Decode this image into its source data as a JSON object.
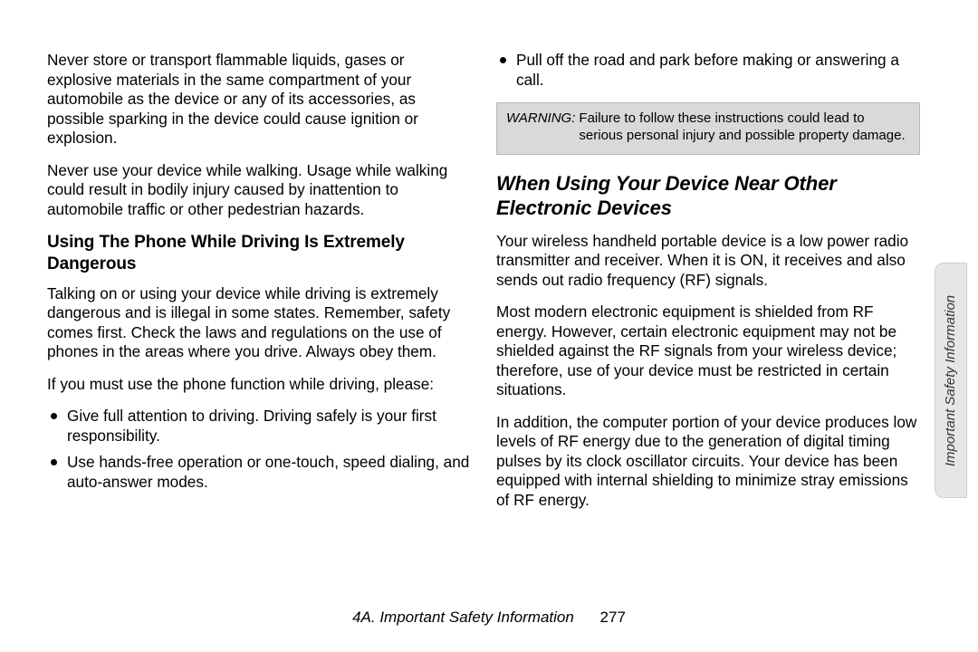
{
  "left": {
    "p1": "Never store or transport flammable liquids, gases or explosive materials in the same compartment of your automobile as the device or any of its accessories, as possible sparking in the device could cause ignition or explosion.",
    "p2": "Never use your device while walking. Usage while walking could result in bodily injury caused by inattention to automobile traffic or other pedestrian hazards.",
    "sub_head": "Using The Phone While Driving Is Extremely Dangerous",
    "p3": "Talking on or using your device while driving is extremely dangerous and is illegal in some states. Remember, safety comes first. Check the laws and regulations on the use of phones in the areas where you drive. Always obey them.",
    "p4": "If you must use the phone function while driving, please:",
    "bullets": [
      "Give full attention to driving. Driving safely is your first responsibility.",
      "Use hands-free operation or one-touch, speed dialing, and auto-answer modes."
    ]
  },
  "right": {
    "bullets_top": [
      "Pull off the road and park before making or answering a call."
    ],
    "warning_label": "WARNING:",
    "warning_text": "Failure to follow these instructions could lead to serious personal injury and possible property damage.",
    "section_head": "When Using Your Device Near Other Electronic Devices",
    "p1": "Your wireless handheld portable device is a low power radio transmitter and receiver. When it is ON, it receives and also sends out radio frequency (RF) signals.",
    "p2": "Most modern electronic equipment is shielded from RF energy. However, certain electronic equipment may not be shielded against the RF signals from your wireless device; therefore, use of your device must be restricted in certain situations.",
    "p3": "In addition, the computer portion of your device produces low levels of RF energy due to the generation of digital timing pulses by its clock oscillator circuits. Your device has been equipped with internal shielding to minimize stray emissions of RF energy."
  },
  "tab_label": "Important Safety Information",
  "footer": {
    "section": "4A. Important Safety Information",
    "page": "277"
  }
}
